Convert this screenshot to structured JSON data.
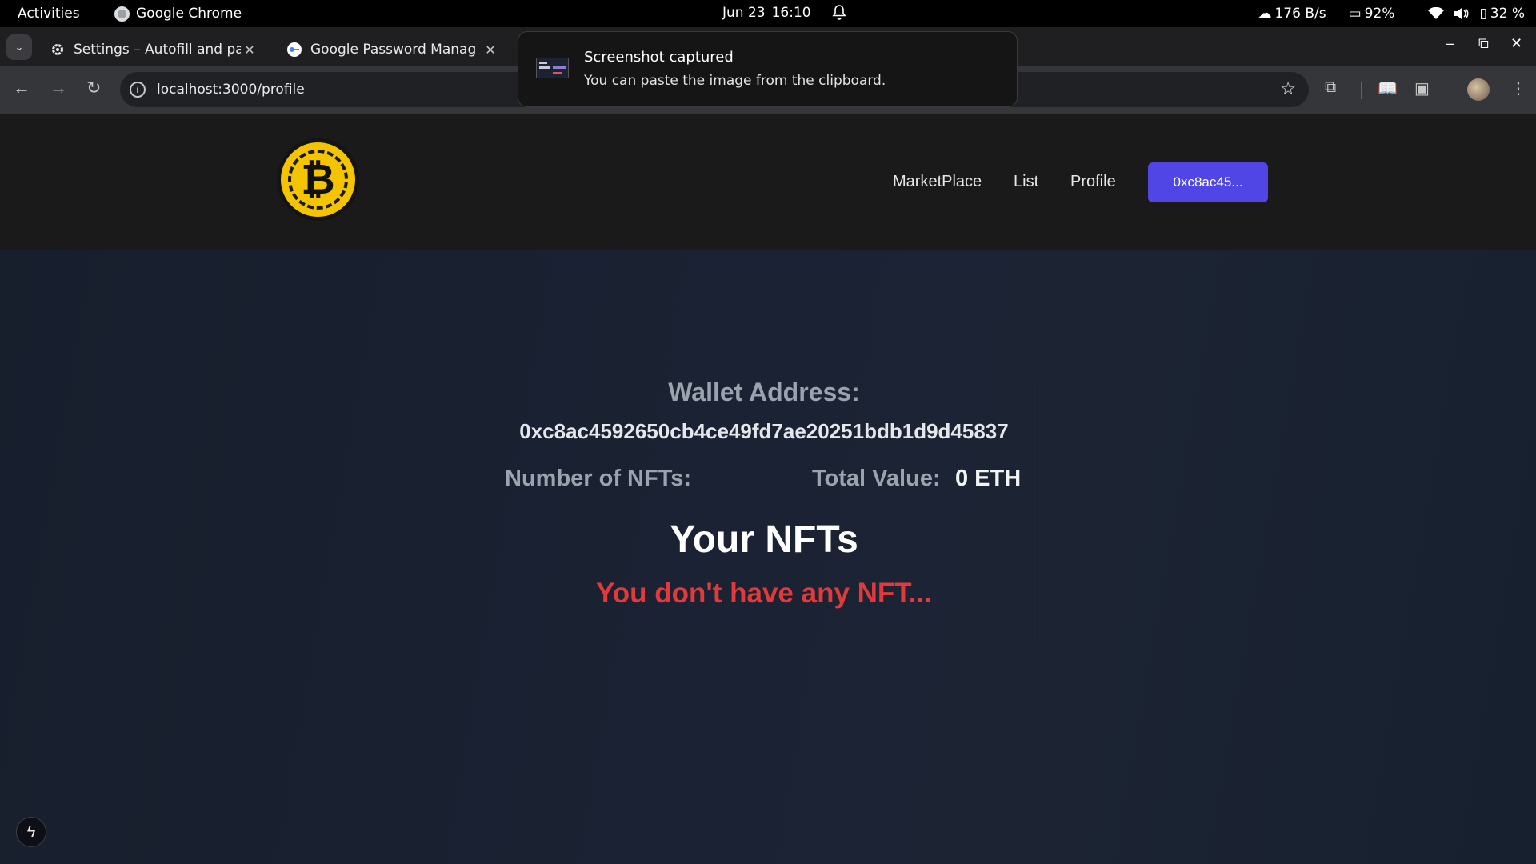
{
  "system_bar": {
    "activities": "Activities",
    "app_name": "Google Chrome",
    "date": "Jun 23",
    "time": "16:10",
    "net_speed": "176 B/s",
    "memory": "92%",
    "battery": "32 %"
  },
  "browser": {
    "tabs": [
      {
        "title": "Settings – Autofill and pa",
        "icon": "gear-icon"
      },
      {
        "title": "Google Password Manag",
        "icon": "google-password-manager-icon"
      }
    ],
    "url": "localhost:3000/profile"
  },
  "notification": {
    "title": "Screenshot captured",
    "body": "You can paste the image from the clipboard."
  },
  "site": {
    "logo_symbol": "₿",
    "nav": {
      "marketplace": "MarketPlace",
      "list": "List",
      "profile": "Profile"
    },
    "wallet_button": "0xc8ac45..."
  },
  "profile": {
    "wallet_label": "Wallet Address:",
    "wallet_address": "0xc8ac4592650cb4ce49fd7ae20251bdb1d9d45837",
    "nft_count_label": "Number of NFTs:",
    "nft_count_value": "",
    "total_value_label": "Total Value:",
    "total_value": "0 ETH",
    "section_title": "Your NFTs",
    "empty_message": "You don't have any NFT..."
  },
  "colors": {
    "accent_button": "#4f46e5",
    "empty_message": "#e23a3a",
    "logo_gold": "#f5c400"
  }
}
